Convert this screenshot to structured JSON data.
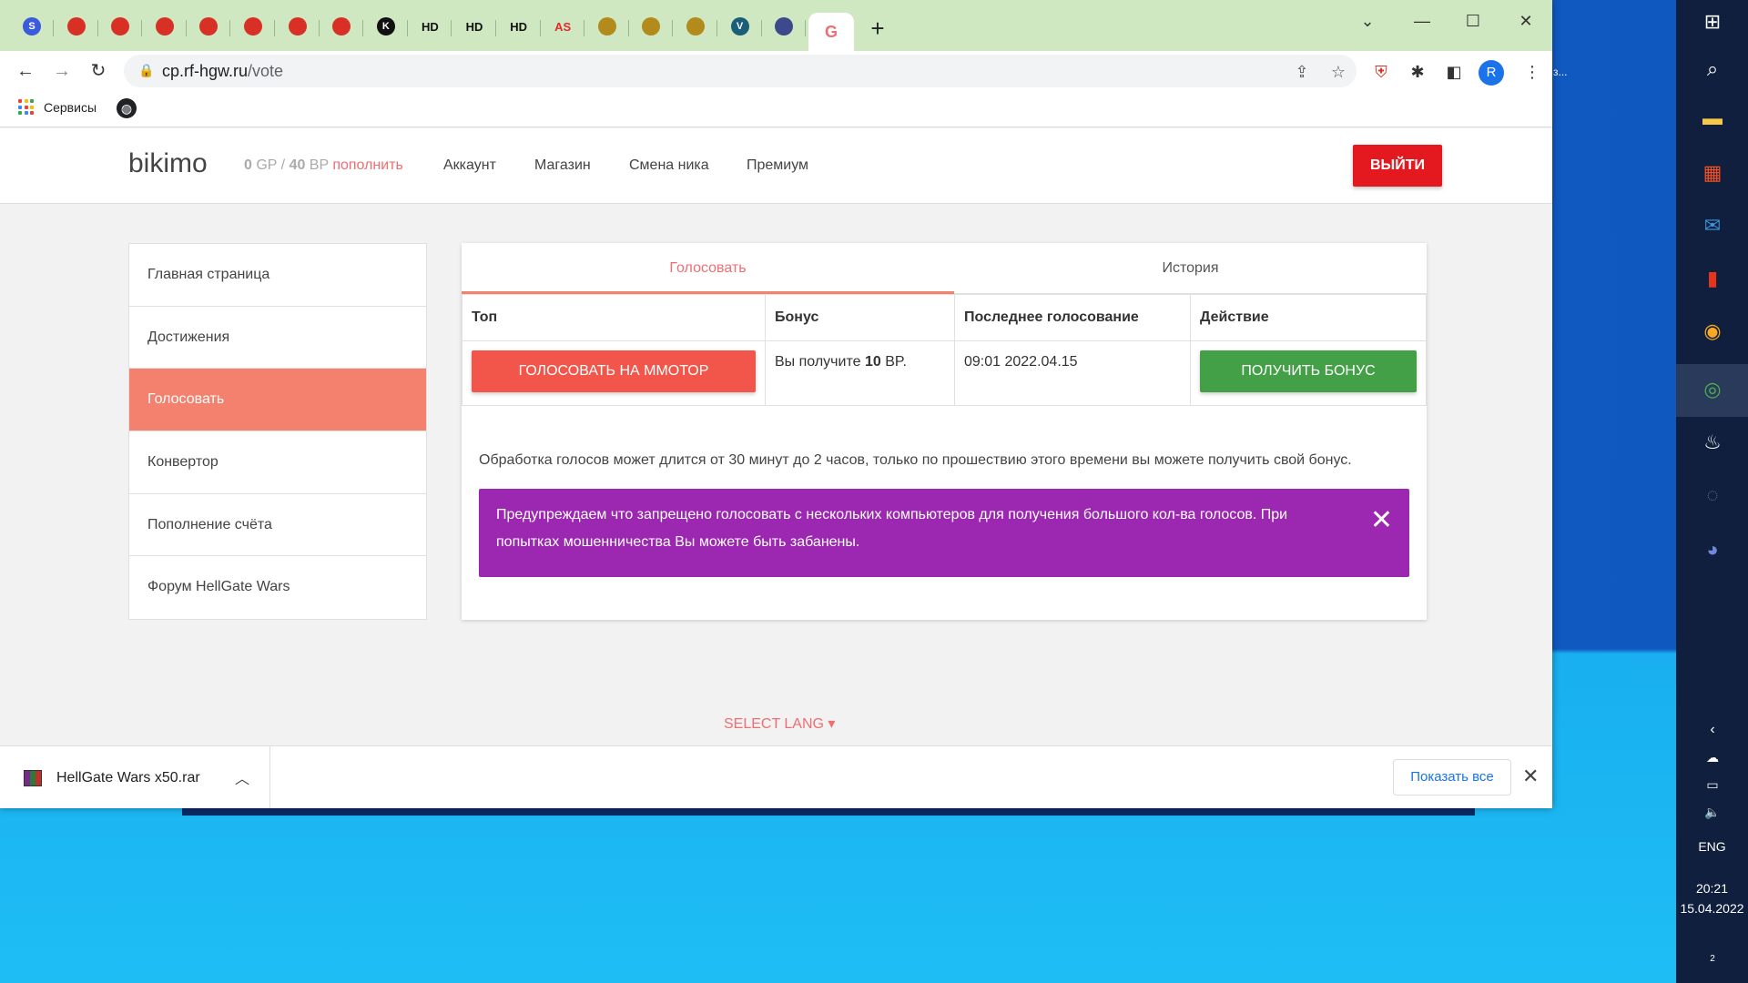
{
  "browser": {
    "tabs_favicons": [
      {
        "name": "s-tab",
        "glyph": "S",
        "color": "#3b5bdb"
      },
      {
        "name": "yt-tab-1",
        "glyph": "",
        "color": "#d93025"
      },
      {
        "name": "yt-tab-2",
        "glyph": "",
        "color": "#d93025"
      },
      {
        "name": "yt-tab-3",
        "glyph": "",
        "color": "#d93025"
      },
      {
        "name": "yt-tab-4",
        "glyph": "",
        "color": "#d93025"
      },
      {
        "name": "yt-tab-5",
        "glyph": "",
        "color": "#d93025"
      },
      {
        "name": "yt-tab-6",
        "glyph": "",
        "color": "#d93025"
      },
      {
        "name": "yt-tab-7",
        "glyph": "",
        "color": "#d93025"
      },
      {
        "name": "k-tab",
        "glyph": "K",
        "color": "#111111"
      },
      {
        "name": "hd-tab-1",
        "glyph": "HD",
        "color": "#111111"
      },
      {
        "name": "hd-tab-2",
        "glyph": "HD",
        "color": "#111111"
      },
      {
        "name": "hd-tab-3",
        "glyph": "HD",
        "color": "#111111"
      },
      {
        "name": "as-tab",
        "glyph": "AS",
        "color": "#e22b2b"
      },
      {
        "name": "wow-tab-1",
        "glyph": "",
        "color": "#b38b1d"
      },
      {
        "name": "wow-tab-2",
        "glyph": "",
        "color": "#b38b1d"
      },
      {
        "name": "wow-tab-3",
        "glyph": "",
        "color": "#b38b1d"
      },
      {
        "name": "v-tab",
        "glyph": "V",
        "color": "#1b5e7a"
      },
      {
        "name": "hex-tab",
        "glyph": "",
        "color": "#3c4a8c"
      }
    ],
    "active_tab_glyph": "G",
    "url_host": "cp.rf-hgw.ru",
    "url_path": "/vote",
    "profile_initial": "R",
    "bookmarks_label": "Сервисы"
  },
  "site": {
    "brand": "bikimo",
    "balance": {
      "gp": "0",
      "gp_unit": "GP",
      "sep": "/",
      "bp": "40",
      "bp_unit": "BP",
      "topup": "пополнить"
    },
    "nav": [
      "Аккаунт",
      "Магазин",
      "Смена ника",
      "Премиум"
    ],
    "logout": "ВЫЙТИ",
    "sidebar": [
      "Главная страница",
      "Достижения",
      "Голосовать",
      "Конвертор",
      "Пополнение счёта",
      "Форум HellGate Wars"
    ],
    "tabs": [
      "Голосовать",
      "История"
    ],
    "table": {
      "headers": [
        "Топ",
        "Бонус",
        "Последнее голосование",
        "Действие"
      ],
      "vote_button": "ГОЛОСОВАТЬ НА ММОТОР",
      "bonus_prefix": "Вы получите",
      "bonus_amount": "10",
      "bonus_suffix": "BP.",
      "last_vote": "09:01 2022.04.15",
      "bonus_button": "ПОЛУЧИТЬ БОНУС"
    },
    "info_text": "Обработка голосов может длится от 30 минут до 2 часов, только по прошествию этого времени вы можете получить свой бонус.",
    "alert_text": "Предупреждаем что запрещено голосовать с нескольких компьютеров для получения большого кол-ва голосов. При попытках мошенничества Вы можете быть забанены.",
    "select_lang": "SELECT LANG"
  },
  "download_bar": {
    "file_name": "HellGate Wars x50.rar",
    "show_all": "Показать все"
  },
  "desktop": {
    "fragment_text": "з..."
  },
  "taskbar": {
    "lang": "ENG",
    "time": "20:21",
    "date": "15.04.2022",
    "notifications": "2"
  },
  "colors": {
    "accent": "#ee6e73",
    "active_sidebar": "#f4806e",
    "logout": "#e3191f",
    "vote_button": "#f2564a",
    "bonus_button": "#43a047",
    "alert": "#9c27b0"
  }
}
